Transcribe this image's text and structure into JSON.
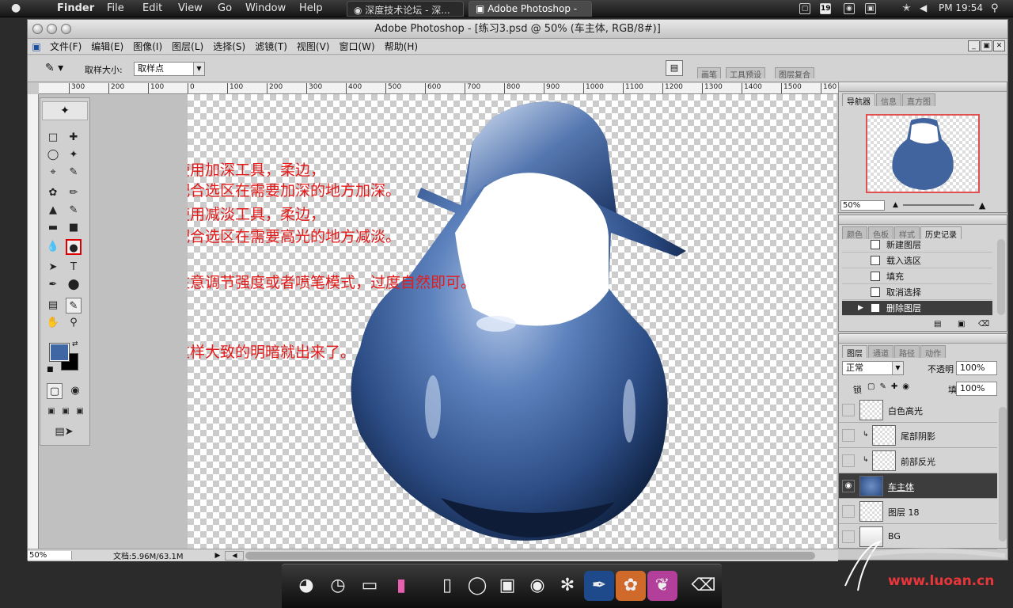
{
  "macbar": {
    "apple": "",
    "menus": [
      "Finder",
      "File",
      "Edit",
      "View",
      "Go",
      "Window",
      "Help"
    ],
    "tabs": [
      "深度技术论坛 - 深...",
      "Adobe Photoshop - ..."
    ],
    "clock": "PM 19:54",
    "status_box": "19"
  },
  "window": {
    "title": "Adobe Photoshop - [练习3.psd @ 50% (车主体, RGB/8#)]"
  },
  "menubar": [
    "文件(F)",
    "编辑(E)",
    "图像(I)",
    "图层(L)",
    "选择(S)",
    "滤镜(T)",
    "视图(V)",
    "窗口(W)",
    "帮助(H)"
  ],
  "options": {
    "sample_label": "取样大小:",
    "sample_value": "取样点",
    "workspace_tabs": [
      "画笔",
      "工具预设",
      "图层复合"
    ]
  },
  "hruler_labels": [
    "300",
    "200",
    "100",
    "0",
    "100",
    "200",
    "300",
    "400",
    "500",
    "600",
    "700",
    "800",
    "900",
    "1000",
    "1100",
    "1200",
    "1300",
    "1400",
    "1500",
    "160"
  ],
  "notes": [
    "使用加深工具，柔边，",
    "配合选区在需要加深的地方加深。",
    "使用减淡工具，柔边，",
    "配合选区在需要高光的地方减淡。",
    "注意调节强度或者喷笔模式，过度自然即可。",
    "这样大致的明暗就出来了。"
  ],
  "status": {
    "zoom": "50%",
    "doc": "文档:5.96M/63.1M"
  },
  "colors": {
    "foreground": "#3e67a3",
    "background": "#000000",
    "accent": "#e31b1b"
  },
  "navigator": {
    "tabs": [
      "导航器",
      "信息",
      "直方图"
    ],
    "zoom": "50%"
  },
  "history": {
    "tabs": [
      "颜色",
      "色板",
      "样式",
      "历史记录"
    ],
    "items": [
      "新建图层",
      "载入选区",
      "填充",
      "取消选择",
      "删除图层"
    ]
  },
  "layers": {
    "tabs": [
      "图层",
      "通道",
      "路径",
      "动作"
    ],
    "blend_mode": "正常",
    "opacity_label": "不透明",
    "opacity": "100%",
    "lock_label": "锁",
    "fill_label": "填",
    "fill": "100%",
    "items": [
      "白色高光",
      "尾部阴影",
      "前部反光",
      "车主体",
      "图层 18",
      "BG"
    ]
  },
  "watermark": {
    "url": "www.luoan.cn"
  },
  "dock_icons": [
    "gamepad-icon",
    "clock-icon",
    "monitor-icon",
    "book-icon",
    "bottle-icon",
    "headphones-icon",
    "truck-icon",
    "robot-icon",
    "network-icon",
    "photoshop-feather-icon",
    "flower-icon",
    "butterfly-icon",
    "trash-icon"
  ]
}
